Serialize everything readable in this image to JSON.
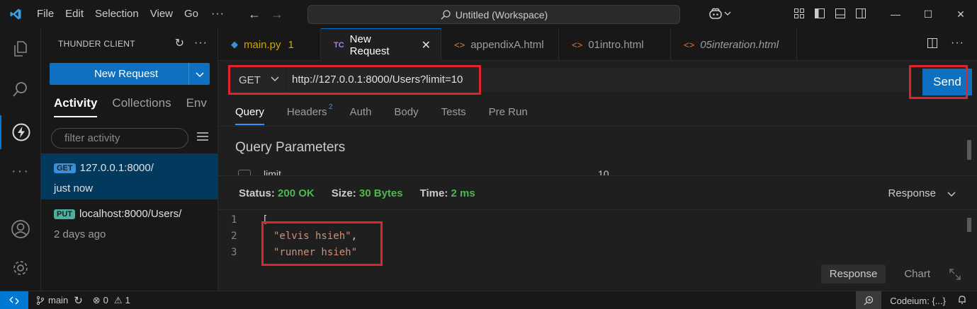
{
  "titlebar": {
    "menu": [
      "File",
      "Edit",
      "Selection",
      "View",
      "Go"
    ],
    "more": "···",
    "workspace": "Untitled (Workspace)"
  },
  "sidebar": {
    "title": "THUNDER CLIENT",
    "new_request": "New Request",
    "tabs": [
      "Activity",
      "Collections",
      "Env"
    ],
    "filter_placeholder": "filter activity",
    "requests": [
      {
        "method": "GET",
        "method_color": "#3b8fd6",
        "url": "127.0.0.1:8000/",
        "time": "just now"
      },
      {
        "method": "PUT",
        "method_color": "#49b09f",
        "url": "localhost:8000/Users/",
        "time": "2 days ago"
      }
    ]
  },
  "tabs": [
    {
      "label": "main.py",
      "icon": "python-icon",
      "badge": "1"
    },
    {
      "label": "New Request",
      "icon": "thunder-client-icon"
    },
    {
      "label": "appendixA.html",
      "icon": "html-icon"
    },
    {
      "label": "01intro.html",
      "icon": "html-icon"
    },
    {
      "label": "05interation.html",
      "icon": "html-icon"
    }
  ],
  "request": {
    "method": "GET",
    "url": "http://127.0.0.1:8000/Users?limit=10",
    "send": "Send",
    "sub_tabs": [
      "Query",
      "Headers",
      "Auth",
      "Body",
      "Tests",
      "Pre Run"
    ],
    "headers_count": "2",
    "query_title": "Query Parameters",
    "param_key": "limit",
    "param_value": "10"
  },
  "response": {
    "status_label": "Status:",
    "status_value": "200 OK",
    "size_label": "Size:",
    "size_value": "30 Bytes",
    "time_label": "Time:",
    "time_value": "2 ms",
    "view_select": "Response",
    "lines": [
      {
        "n": "1",
        "text": "["
      },
      {
        "n": "2",
        "text": "\"elvis hsieh\"",
        "trail": ","
      },
      {
        "n": "3",
        "text": "\"runner hsieh\"",
        "trail": ""
      }
    ],
    "bottom_tabs": [
      "Response",
      "Chart"
    ]
  },
  "statusbar": {
    "branch": "main",
    "errors": "0",
    "warnings": "1",
    "codeium": "Codeium: {...}"
  },
  "colors": {
    "accent": "#0078d4",
    "button": "#0e70c0",
    "highlight": "#e0242e",
    "success": "#4eb84b",
    "string": "#ce9178"
  }
}
